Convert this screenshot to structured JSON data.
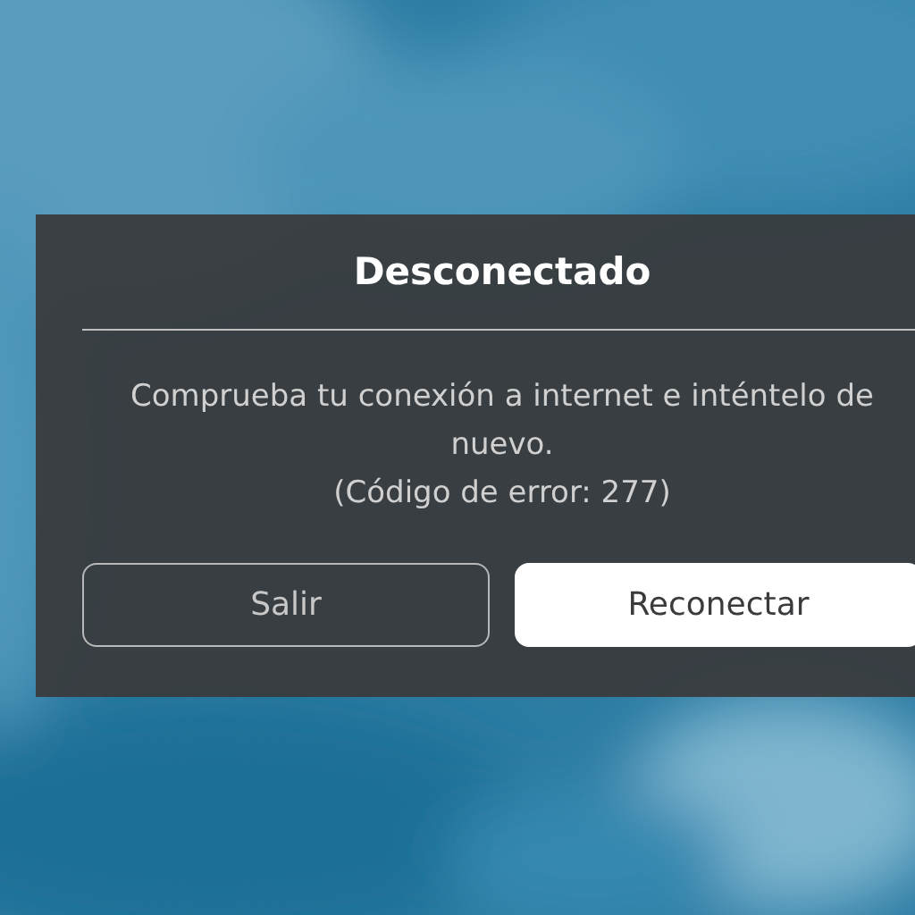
{
  "dialog": {
    "title": "Desconectado",
    "message": "Comprueba tu conexión a internet e inténtelo de nuevo.",
    "error_code": "(Código de error: 277)",
    "buttons": [
      {
        "label": "Salir",
        "kind": "secondary"
      },
      {
        "label": "Reconectar",
        "kind": "primary"
      }
    ]
  }
}
